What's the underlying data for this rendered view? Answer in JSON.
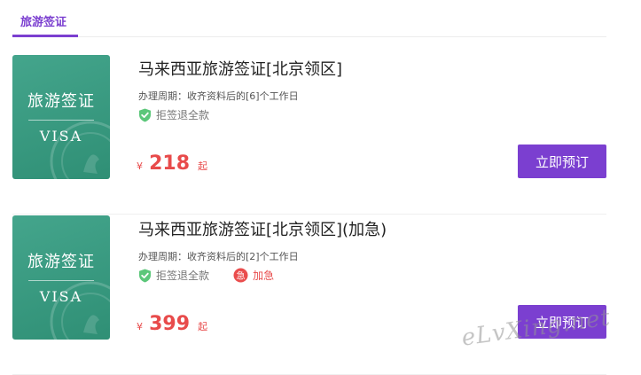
{
  "tabs": [
    {
      "label": "旅游签证",
      "active": true
    }
  ],
  "thumb": {
    "title": "旅游签证",
    "subtitle": "VISA"
  },
  "items": [
    {
      "title": "马来西亚旅游签证[北京领区]",
      "period": "办理周期：收齐资料后的[6]个工作日",
      "tags": [
        {
          "label": "拒签退全款",
          "icon": "shield-check-icon"
        }
      ],
      "currency": "¥",
      "price": "218",
      "price_unit": "起",
      "button": "立即预订"
    },
    {
      "title": "马来西亚旅游签证[北京领区](加急)",
      "period": "办理周期：收齐资料后的[2]个工作日",
      "tags": [
        {
          "label": "拒签退全款",
          "icon": "shield-check-icon"
        },
        {
          "label": "加急",
          "icon": "urgent-badge-icon",
          "badge": "急"
        }
      ],
      "currency": "¥",
      "price": "399",
      "price_unit": "起",
      "button": "立即预订"
    }
  ],
  "watermark": "eLvXing.net",
  "colors": {
    "accent": "#7b3fd0",
    "price": "#e84b4b",
    "thumb": "#3a9a80",
    "shield": "#5cc77a"
  }
}
